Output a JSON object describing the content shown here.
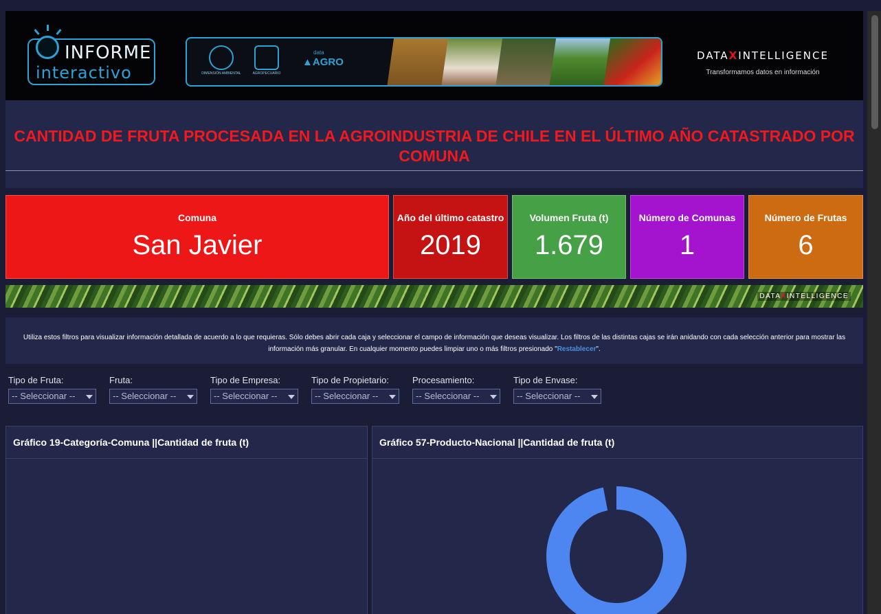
{
  "header": {
    "informe_line1": "INFORME",
    "informe_line2": "interactivo",
    "partner1_caption": "DIMENSIÓN AMBIENTAL",
    "partner2_caption": "AGROPECUARIO",
    "dataagro_small": "data",
    "dataagro_big": "AGRO",
    "di_name_left": "DATA",
    "di_name_x": "X",
    "di_name_right": "INTELLIGENCE",
    "di_tagline": "Transformamos datos en información"
  },
  "title": "CANTIDAD DE FRUTA PROCESADA EN LA AGROINDUSTRIA DE CHILE EN EL ÚLTIMO AÑO CATASTRADO POR COMUNA",
  "kpis": [
    {
      "label": "Comuna",
      "value": "San Javier",
      "color": "#ee1717"
    },
    {
      "label": "Año del último catastro",
      "value": "2019",
      "color": "#c51212"
    },
    {
      "label": "Volumen Fruta (t)",
      "value": "1.679",
      "color": "#45a046"
    },
    {
      "label": "Número de Comunas",
      "value": "1",
      "color": "#a414cf"
    },
    {
      "label": "Número de Frutas",
      "value": "6",
      "color": "#cc6b12"
    }
  ],
  "instructions": {
    "text_before": "Utiliza estos filtros para visualizar información detallada de acuerdo a lo que requieras. Sólo debes abrir cada caja y seleccionar el campo de información que deseas visualizar. Los filtros de las distintas cajas se irán anidando con cada selección anterior para mostrar las información más granular. En cualquier momento puedes limpiar uno o más filtros presionado \"",
    "link": "Restablecer",
    "text_after": "\"."
  },
  "filters": [
    {
      "label": "Tipo de Fruta:",
      "value": "-- Seleccionar --"
    },
    {
      "label": "Fruta:",
      "value": "-- Seleccionar --"
    },
    {
      "label": "Tipo de Empresa:",
      "value": "-- Seleccionar --"
    },
    {
      "label": "Tipo de Propietario:",
      "value": "-- Seleccionar --"
    },
    {
      "label": "Procesamiento:",
      "value": "-- Seleccionar --"
    },
    {
      "label": "Tipo de Envase:",
      "value": "-- Seleccionar --"
    }
  ],
  "panels": {
    "left_title": "Gráfico 19-Categoría-Comuna ||Cantidad de fruta (t)",
    "right_title": "Gráfico 57-Producto-Nacional ||Cantidad de fruta (t)"
  },
  "chart_data": {
    "type": "pie",
    "title": "Gráfico 57-Producto-Nacional ||Cantidad de fruta (t)",
    "slices": [
      {
        "value": 0.97,
        "color": "#4d86f0"
      },
      {
        "value": 0.03,
        "color": "#23284a"
      }
    ],
    "donut": true
  },
  "colors": {
    "background": "#1a1d35",
    "panel": "#23284a",
    "title_red": "#f0191e",
    "accent_blue": "#2aa3d6"
  }
}
